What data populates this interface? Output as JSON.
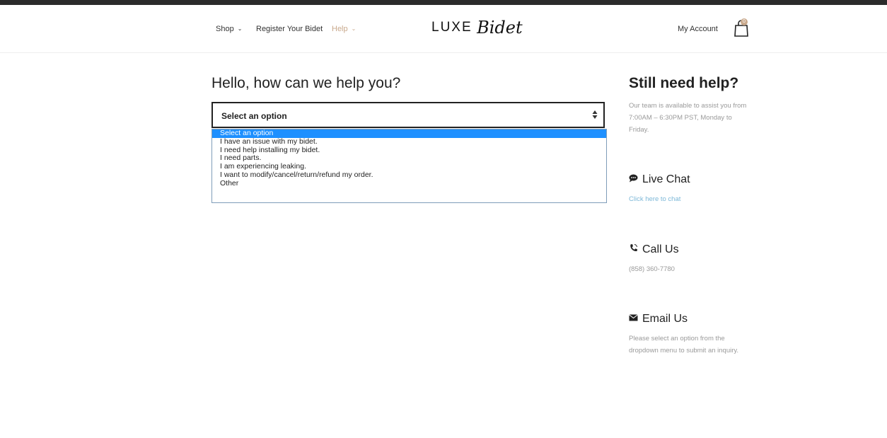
{
  "nav": {
    "shop": "Shop",
    "register": "Register Your Bidet",
    "help": "Help"
  },
  "logo": {
    "luxe": "LUXE",
    "bidet": "Bidet"
  },
  "account": {
    "label": "My Account",
    "cart_count": "0"
  },
  "main": {
    "title": "Hello, how can we help you?",
    "select": {
      "value": "Select an option",
      "options": [
        "Select an option",
        "I have an issue with my bidet.",
        "I need help installing my bidet.",
        "I need parts.",
        "I am experiencing leaking.",
        "I want to modify/cancel/return/refund my order.",
        "Other"
      ]
    }
  },
  "sidebar": {
    "title": "Still need help?",
    "intro": "Our team is available to assist you from 7:00AM – 6:30PM PST, Monday to Friday.",
    "live_chat": {
      "title": "Live Chat",
      "link": "Click here to chat"
    },
    "call": {
      "title": "Call Us",
      "phone": "(858) 360-7780"
    },
    "email": {
      "title": "Email Us",
      "text": "Please select an option from the dropdown menu to submit an inquiry."
    }
  },
  "colors": {
    "accent": "#c9a98c",
    "link": "#7db8d8",
    "selected_option": "#1e90ff"
  }
}
